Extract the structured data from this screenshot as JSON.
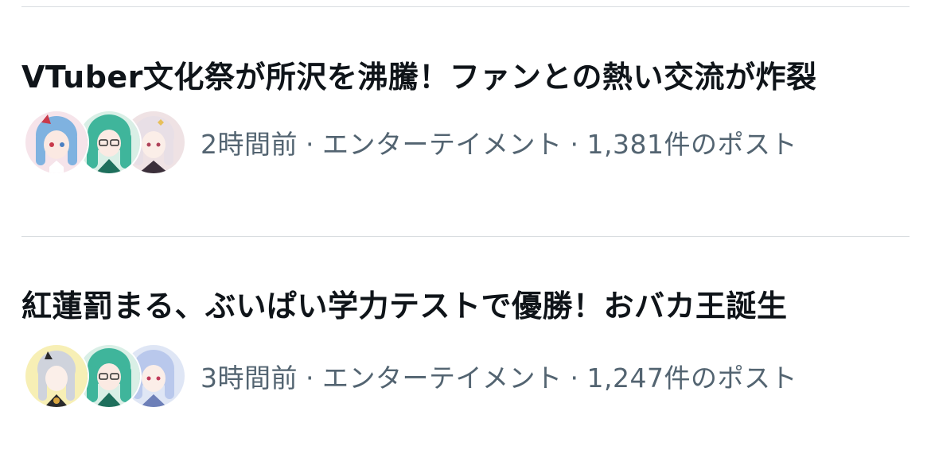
{
  "trends": [
    {
      "title": "VTuber文化祭が所沢を沸騰！ファンとの熱い交流が炸裂",
      "time": "2時間前",
      "category": "エンターテイメント",
      "posts": "1,381件のポスト",
      "separator": "·",
      "avatars": [
        {
          "name": "blue-hair-girl-avatar",
          "bg": "#f6e4ea",
          "hair": "#7fb2e0",
          "accent": "#c93a4b"
        },
        {
          "name": "green-hair-girl-avatar",
          "bg": "#d9efe6",
          "hair": "#3fb59b",
          "accent": "#1e6f5c"
        },
        {
          "name": "white-hair-girl-avatar",
          "bg": "#efe2e4",
          "hair": "#e8dfe6",
          "accent": "#3b2f3a"
        }
      ]
    },
    {
      "title": "紅蓮罰まる、ぶいぱい学力テストで優勝！おバカ王誕生",
      "time": "3時間前",
      "category": "エンターテイメント",
      "posts": "1,247件のポスト",
      "separator": "·",
      "avatars": [
        {
          "name": "silver-hair-girl-avatar",
          "bg": "#f7efb5",
          "hair": "#cfd3dc",
          "accent": "#2b2b2b"
        },
        {
          "name": "green-hair-girl-avatar",
          "bg": "#d9efe6",
          "hair": "#3fb59b",
          "accent": "#1e6f5c"
        },
        {
          "name": "lightblue-hair-girl-avatar",
          "bg": "#dfe6f5",
          "hair": "#b9c8ec",
          "accent": "#c23a5a"
        }
      ]
    }
  ]
}
